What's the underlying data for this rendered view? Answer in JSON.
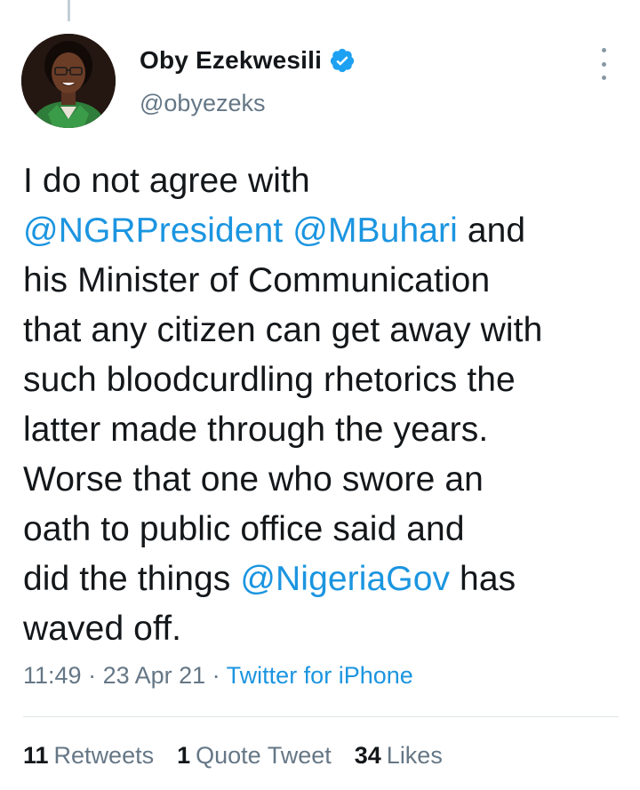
{
  "author": {
    "display_name": "Oby Ezekwesili",
    "handle": "@obyezeks",
    "verified": true
  },
  "tweet": {
    "lines": [
      [
        {
          "t": "I do not agree with",
          "m": false
        }
      ],
      [
        {
          "t": "@NGRPresident",
          "m": true
        },
        {
          "t": " ",
          "m": false
        },
        {
          "t": "@MBuhari",
          "m": true
        },
        {
          "t": " and",
          "m": false
        }
      ],
      [
        {
          "t": "his Minister of Communication",
          "m": false
        }
      ],
      [
        {
          "t": "that any citizen can get away with",
          "m": false
        }
      ],
      [
        {
          "t": "such bloodcurdling rhetorics the",
          "m": false
        }
      ],
      [
        {
          "t": "latter made through the years.",
          "m": false
        }
      ],
      [
        {
          "t": "Worse that one who swore an",
          "m": false
        }
      ],
      [
        {
          "t": "oath to public office said and",
          "m": false
        }
      ],
      [
        {
          "t": "did the things ",
          "m": false
        },
        {
          "t": "@NigeriaGov",
          "m": true
        },
        {
          "t": " has",
          "m": false
        }
      ],
      [
        {
          "t": "waved off.",
          "m": false
        }
      ]
    ]
  },
  "meta": {
    "time": "11:49",
    "separator": " · ",
    "date": "23 Apr 21",
    "source": "Twitter for iPhone"
  },
  "stats": {
    "retweets_count": "11",
    "retweets_label": "Retweets",
    "quotes_count": "1",
    "quotes_label": "Quote Tweet",
    "likes_count": "34",
    "likes_label": "Likes"
  },
  "colors": {
    "link": "#1b95e0",
    "secondary_text": "#657786",
    "primary_text": "#14171a",
    "verified": "#1da1f2"
  },
  "icons": {
    "verified": "verified-badge-icon",
    "more": "more-vertical-icon"
  }
}
